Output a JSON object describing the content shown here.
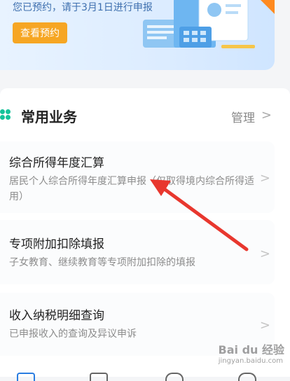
{
  "banner": {
    "text": "您已预约，请于3月1日进行申报",
    "button_label": "查看预约"
  },
  "section": {
    "title": "常用业务",
    "manage_label": "管理",
    "chevron": ">"
  },
  "items": [
    {
      "title": "综合所得年度汇算",
      "desc": "居民个人综合所得年度汇算申报（仅取得境内综合所得适用）"
    },
    {
      "title": "专项附加扣除填报",
      "desc": "子女教育、继续教育等专项附加扣除的填报"
    },
    {
      "title": "收入纳税明细查询",
      "desc": "已申报收入的查询及异议申诉"
    }
  ],
  "watermark": {
    "text": "Bai du 经验",
    "sub": "jingyan.baidu.com"
  },
  "colors": {
    "accent_orange": "#f6a623",
    "dot_green": "#15c39a",
    "arrow_red": "#e8372e"
  }
}
